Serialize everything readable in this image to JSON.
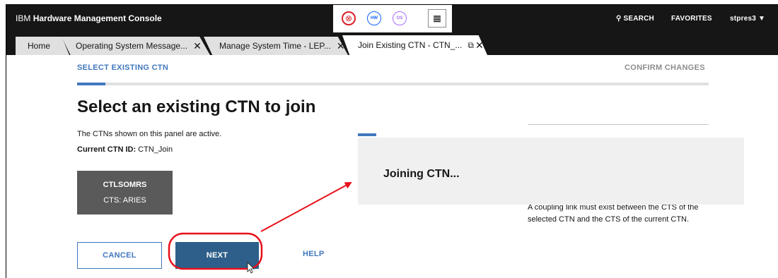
{
  "header": {
    "brand_prefix": "IBM",
    "app_name": "Hardware Management Console",
    "status_icons": [
      {
        "name": "exceptions-icon",
        "glyph": "⊗",
        "color": "#da1e28"
      },
      {
        "name": "hardware-messages-icon",
        "glyph": "HW",
        "color": "#0f62fe"
      },
      {
        "name": "os-messages-icon",
        "glyph": "OS",
        "color": "#a56eff"
      }
    ],
    "tasklist_glyph": "≣",
    "search_label": "SEARCH",
    "search_glyph": "⚲",
    "favorites_label": "FAVORITES",
    "user_label": "stpres3",
    "user_caret": "▼"
  },
  "tabs": [
    {
      "label": "Home"
    },
    {
      "label": "Operating System Message...",
      "close": "✕"
    },
    {
      "label": "Manage System Time - LEP...",
      "close": "✕"
    },
    {
      "label": "Join Existing CTN - CTN_...",
      "popout": "⧉",
      "close": "✕",
      "active": true
    }
  ],
  "progress": {
    "steps": [
      {
        "label": "SELECT EXISTING CTN",
        "state": "current"
      },
      {
        "label": "CONFIRM CHANGES",
        "state": "upcoming"
      }
    ]
  },
  "main": {
    "title": "Select an existing CTN to join",
    "intro": "The CTNs shown on this panel are active.",
    "current_ctn_label": "Current CTN ID:",
    "current_ctn_value": "CTN_Join",
    "ctn_tile": {
      "name": "CTLSOMRS",
      "cts": "CTS: ARIES"
    },
    "info_text": "A coupling link must exist between the CTS of the selected CTN and the CTS of the current CTN."
  },
  "overlay": {
    "message": "Joining CTN..."
  },
  "buttons": {
    "cancel": "CANCEL",
    "next": "NEXT",
    "help": "HELP"
  },
  "colors": {
    "header_bg": "#161616",
    "accent_blue": "#4178be",
    "primary_button": "#2d5f8a",
    "tile_bg": "#5a5a5a",
    "annotation_red": "#e8101a"
  }
}
